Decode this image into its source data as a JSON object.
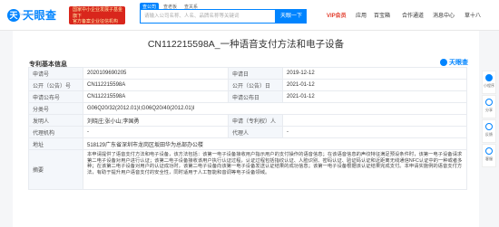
{
  "header": {
    "logo_mark": "天",
    "logo_text": "天眼查",
    "logo_sub": "TianYanCha.com",
    "promo_line1": "国家中小企业发展子基金旗下",
    "promo_line2": "官方备案企业征信机构",
    "search_tabs": [
      "查公司",
      "查老板",
      "查关系"
    ],
    "search_placeholder": "请输入公司名称、人名、品牌名称等关键词",
    "search_button": "天眼一下",
    "nav_vip": "VIP会员",
    "nav_app": "应用",
    "nav_service": "百宝箱",
    "nav_coop": "合作通道",
    "nav_msg": "消息中心",
    "nav_user": "草十八"
  },
  "page": {
    "title": "CN112215598A_一种语音支付方法和电子设备",
    "section_title": "专利基本信息",
    "brand_badge": "天眼查"
  },
  "info": {
    "labels": {
      "app_no": "申请号",
      "app_date": "申请日",
      "pub_no": "公开（公告）号",
      "pub_date": "公开（公告）日",
      "app_pub_no": "申请公布号",
      "app_pub_date": "申请公布日",
      "class_no": "分类号",
      "inventor": "发明人",
      "applicant": "申请（专利权）人",
      "agency": "代理机构",
      "agent": "代理人",
      "address": "地址",
      "abstract": "摘要"
    },
    "values": {
      "app_no": "2020109690205",
      "app_date": "2019-12-12",
      "pub_no": "CN112215598A",
      "pub_date": "2021-01-12",
      "app_pub_no": "CN112215598A",
      "app_pub_date": "2021-01-12",
      "class_no": "G06Q20/32(2012.01)I;G06Q20/40(2012.01)I",
      "inventor": "刘晓庄;张小山;李国勇",
      "applicant": "",
      "agency": "-",
      "agent": "-",
      "address": "518129广东省深圳市龙岗区坂田华为总部办公楼",
      "abstract": "本申请提供了语音支付方法和电子设备，该方法包括：该第一电子设备接收用户指示用户的支付操作的语音信息；在该语音信息的声纹特征满足预设条件时，该第一电子设备请求第二电子设备对用户进行认证；该第二电子设备接收该用户执行认证过程，认证过程包括指纹认证、人脸识别、密码认证、验证码认证和近距离无线通信NFC认证中的一种或者多种；在该第二电子设备对用户的认证成功时，该第二电子设备向该第一电子设备发送认证结果的成功信息；该第一电子设备根据该认证结果完成支付。本申请实施例的语音支付方法，有助于提升用户语音支付的安全性，同时适用于人工智能和音调等电子设备领域。"
    }
  },
  "float_bar": [
    "小程序",
    "分享",
    "反馈",
    "客服"
  ]
}
